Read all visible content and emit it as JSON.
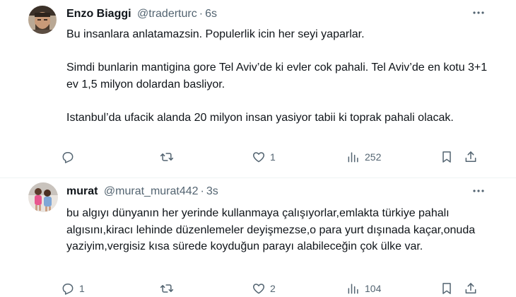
{
  "tweets": [
    {
      "name": "Enzo Biaggi",
      "handle": "@traderturc",
      "separator": "·",
      "time": "6s",
      "paragraphs": [
        "Bu insanlara anlatamazsin. Populerlik icin her seyi yaparlar.",
        "Simdi bunlarin mantigina gore Tel Aviv’de ki evler cok pahali. Tel Aviv’de en kotu 3+1 ev 1,5 milyon dolardan basliyor.",
        "Istanbul’da ufacik alanda 20 milyon insan yasiyor tabii ki toprak pahali olacak."
      ],
      "reply_count": "",
      "retweet_count": "",
      "like_count": "1",
      "view_count": "252"
    },
    {
      "name": "murat",
      "handle": "@murat_murat442",
      "separator": "·",
      "time": "3s",
      "paragraphs": [
        "bu algıyı dünyanın her yerinde kullanmaya çalışıyorlar,emlakta türkiye pahalı algısını,kiracı lehinde düzenlemeler deyişmezse,o para yurt dışınada kaçar,onuda yaziyim,vergisiz kısa sürede koyduğun parayı alabileceğin çok ülke var."
      ],
      "reply_count": "1",
      "retweet_count": "",
      "like_count": "2",
      "view_count": "104"
    }
  ],
  "icons": {
    "reply": "reply-icon",
    "retweet": "retweet-icon",
    "like": "heart-icon",
    "views": "views-icon",
    "bookmark": "bookmark-icon",
    "share": "share-icon",
    "more": "more-icon"
  },
  "colors": {
    "text": "#0f1419",
    "secondary": "#536471",
    "divider": "#eff3f4"
  }
}
